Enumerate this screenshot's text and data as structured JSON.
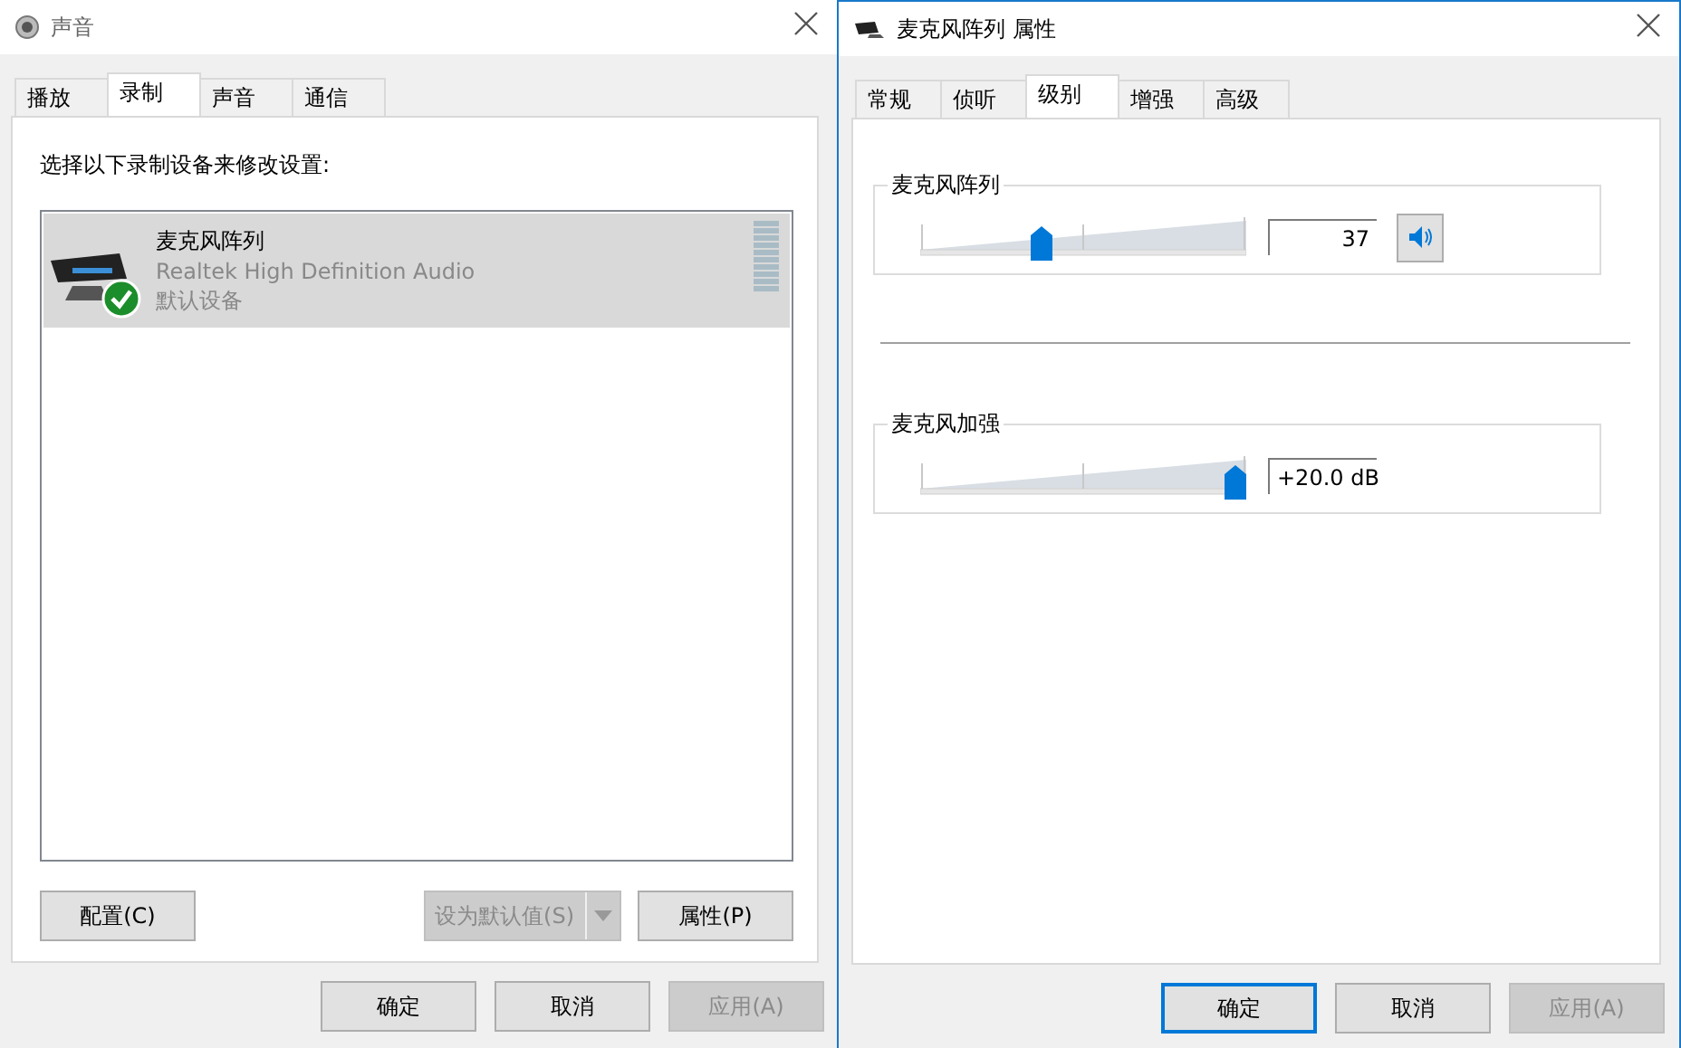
{
  "left_window": {
    "title": "声音",
    "tabs": [
      {
        "label": "播放",
        "selected": false
      },
      {
        "label": "录制",
        "selected": true
      },
      {
        "label": "声音",
        "selected": false
      },
      {
        "label": "通信",
        "selected": false
      }
    ],
    "instruction": "选择以下录制设备来修改设置:",
    "devices": [
      {
        "name": "麦克风阵列",
        "driver": "Realtek High Definition Audio",
        "status": "默认设备",
        "selected": true,
        "default": true
      }
    ],
    "buttons": [
      {
        "label": "配置(C)",
        "kind": "plain",
        "disabled": false
      },
      {
        "label": "设为默认值(S)",
        "kind": "split",
        "disabled": true
      },
      {
        "label": "属性(P)",
        "kind": "plain",
        "disabled": false
      }
    ],
    "dialog_buttons": [
      {
        "label": "确定",
        "disabled": false,
        "focused": false
      },
      {
        "label": "取消",
        "disabled": false,
        "focused": false
      },
      {
        "label": "应用(A)",
        "disabled": true,
        "focused": false
      }
    ]
  },
  "right_window": {
    "title": "麦克风阵列 属性",
    "tabs": [
      {
        "label": "常规",
        "selected": false
      },
      {
        "label": "侦听",
        "selected": false
      },
      {
        "label": "级别",
        "selected": true
      },
      {
        "label": "增强",
        "selected": false
      },
      {
        "label": "高级",
        "selected": false
      }
    ],
    "groups": [
      {
        "label": "麦克风阵列",
        "level": 0.37,
        "reading": "37",
        "kind": "volume"
      },
      {
        "label": "麦克风加强",
        "level": 1.0,
        "reading": "+20.0 dB",
        "kind": "boost"
      }
    ],
    "dialog_buttons": [
      {
        "label": "确定",
        "disabled": false,
        "focused": true
      },
      {
        "label": "取消",
        "disabled": false,
        "focused": false
      },
      {
        "label": "应用(A)",
        "disabled": true,
        "focused": false
      }
    ]
  }
}
